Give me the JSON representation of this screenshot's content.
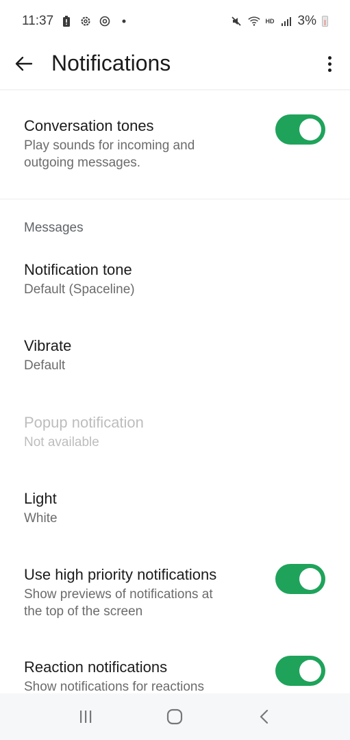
{
  "status_bar": {
    "time": "11:37",
    "left_icons": [
      "battery-saver-icon",
      "settings-gear-icon",
      "data-saver-icon",
      "dot-icon"
    ],
    "right_icons": [
      "mute-icon",
      "wifi-icon",
      "hd-icon",
      "signal-icon"
    ],
    "hd_label": "HD",
    "battery_percent": "3%"
  },
  "app_bar": {
    "back_icon": "arrow-left-icon",
    "title": "Notifications",
    "more_icon": "more-vert-icon"
  },
  "conversation_tones": {
    "title": "Conversation tones",
    "subtitle_line1": "Play sounds for incoming and",
    "subtitle_line2": "outgoing messages.",
    "enabled": true
  },
  "messages_section": {
    "header": "Messages",
    "items": [
      {
        "title": "Notification tone",
        "value": "Default (Spaceline)",
        "disabled": false
      },
      {
        "title": "Vibrate",
        "value": "Default",
        "disabled": false
      },
      {
        "title": "Popup notification",
        "value": "Not available",
        "disabled": true
      },
      {
        "title": "Light",
        "value": "White",
        "disabled": false
      }
    ],
    "high_priority": {
      "title": "Use high priority notifications",
      "subtitle_line1": "Show previews of notifications at",
      "subtitle_line2": "the top of the screen",
      "enabled": true
    },
    "reaction": {
      "title": "Reaction notifications",
      "subtitle_line1": "Show notifications for reactions",
      "enabled": true
    }
  },
  "colors": {
    "accent": "#1fa35b",
    "disabled_text": "#bdbdbd"
  },
  "nav_bar": {
    "buttons": [
      "recents-icon",
      "home-icon",
      "back-icon"
    ]
  }
}
